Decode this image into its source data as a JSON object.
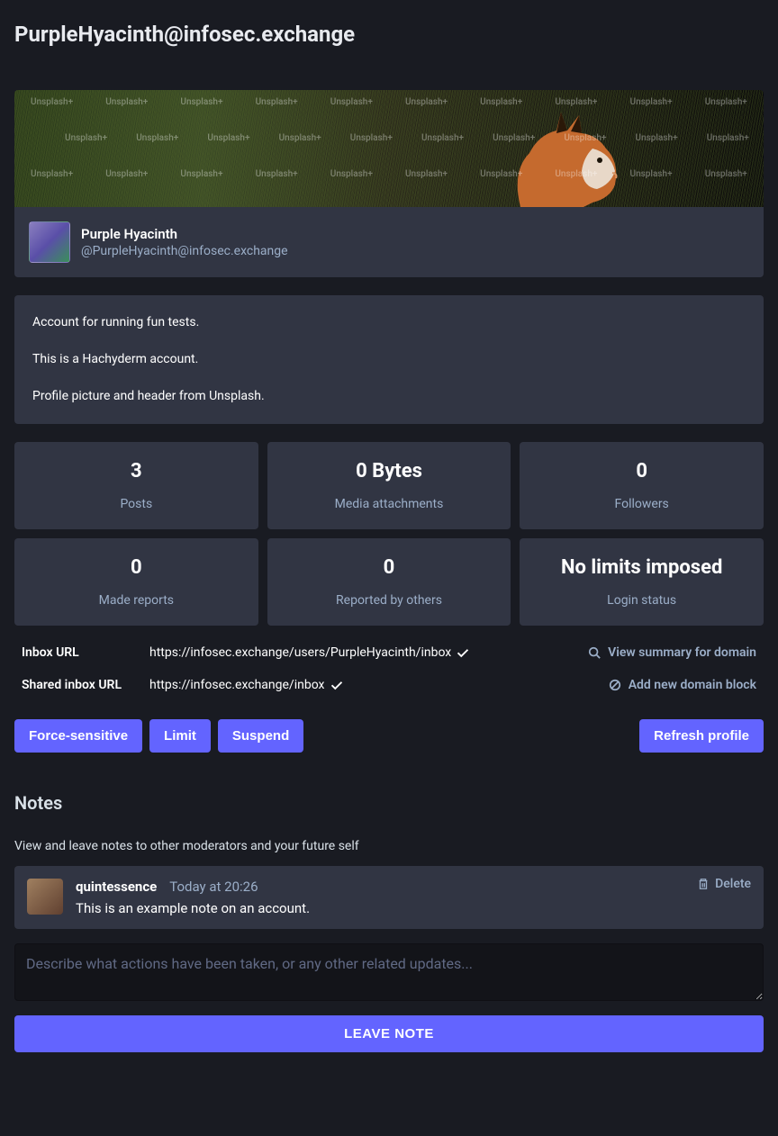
{
  "page_title": "PurpleHyacinth@infosec.exchange",
  "profile": {
    "display_name": "Purple Hyacinth",
    "handle": "@PurpleHyacinth@infosec.exchange",
    "bio_1": "Account for running fun tests.",
    "bio_2": "This is a Hachyderm account.",
    "bio_3": "Profile picture and header from Unsplash."
  },
  "watermark_text": "Unsplash+",
  "stats": {
    "posts": {
      "value": "3",
      "label": "Posts"
    },
    "media": {
      "value": "0 Bytes",
      "label": "Media attachments"
    },
    "followers": {
      "value": "0",
      "label": "Followers"
    },
    "made_reports": {
      "value": "0",
      "label": "Made reports"
    },
    "reported_by": {
      "value": "0",
      "label": "Reported by others"
    },
    "login": {
      "value": "No limits imposed",
      "label": "Login status"
    }
  },
  "details": {
    "inbox_label": "Inbox URL",
    "inbox_value": "https://infosec.exchange/users/PurpleHyacinth/inbox",
    "shared_label": "Shared inbox URL",
    "shared_value": "https://infosec.exchange/inbox",
    "view_summary": "View summary for domain",
    "add_block": "Add new domain block"
  },
  "actions": {
    "force_sensitive": "Force-sensitive",
    "limit": "Limit",
    "suspend": "Suspend",
    "refresh": "Refresh profile"
  },
  "notes": {
    "heading": "Notes",
    "desc": "View and leave notes to other moderators and your future self",
    "entry": {
      "author": "quintessence",
      "time": "Today at 20:26",
      "text": "This is an example note on an account.",
      "delete_label": "Delete"
    },
    "placeholder": "Describe what actions have been taken, or any other related updates...",
    "submit": "LEAVE NOTE"
  }
}
